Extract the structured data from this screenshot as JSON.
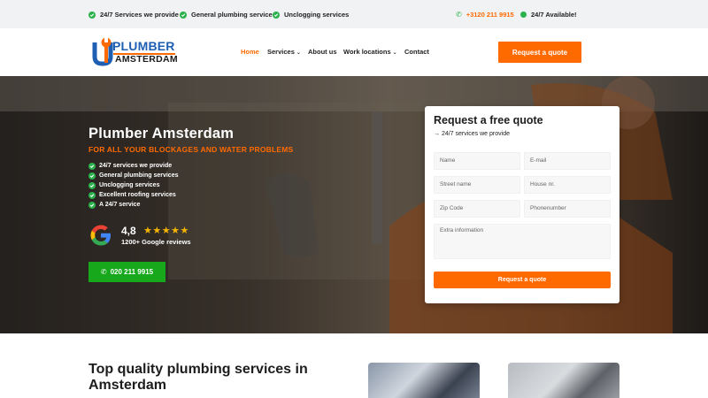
{
  "topbar": {
    "features": [
      "24/7 Services we provide",
      "General plumbing service",
      "Unclogging services"
    ],
    "phone": "+3120 211 9915",
    "availability": "24/7 Available!"
  },
  "brand": {
    "word1": "PLUMBER",
    "word2": "AMSTERDAM"
  },
  "nav": {
    "items": [
      "Home",
      "Services",
      "About us",
      "Work locations",
      "Contact"
    ],
    "cta": "Request a quote"
  },
  "hero": {
    "title": "Plumber Amsterdam",
    "subtitle": "FOR ALL YOUR BLOCKAGES AND WATER PROBLEMS",
    "bullets": [
      "24/7 services we provide",
      "General plumbing services",
      "Unclogging services",
      "Excellent roofing services",
      "A 24/7 service"
    ],
    "rating": "4,8",
    "stars": "★★★★★",
    "reviews": "1200+ Google reviews",
    "call_label": "020 211 9915"
  },
  "form": {
    "title": "Request a free quote",
    "tagline": "→ 24/7 services we provide",
    "placeholders": {
      "name": "Name",
      "email": "E-mail",
      "street": "Street name",
      "house": "House nr.",
      "zip": "Zip Code",
      "phone": "Phonenumber",
      "extra": "Extra information"
    },
    "submit": "Request a quote"
  },
  "section": {
    "title": "Top quality plumbing services in Amsterdam"
  },
  "colors": {
    "accent": "#ff6a00",
    "brand_blue": "#1e5fb4",
    "call_green": "#18a81c",
    "check_green": "#2bb24c",
    "star": "#f5b400"
  }
}
